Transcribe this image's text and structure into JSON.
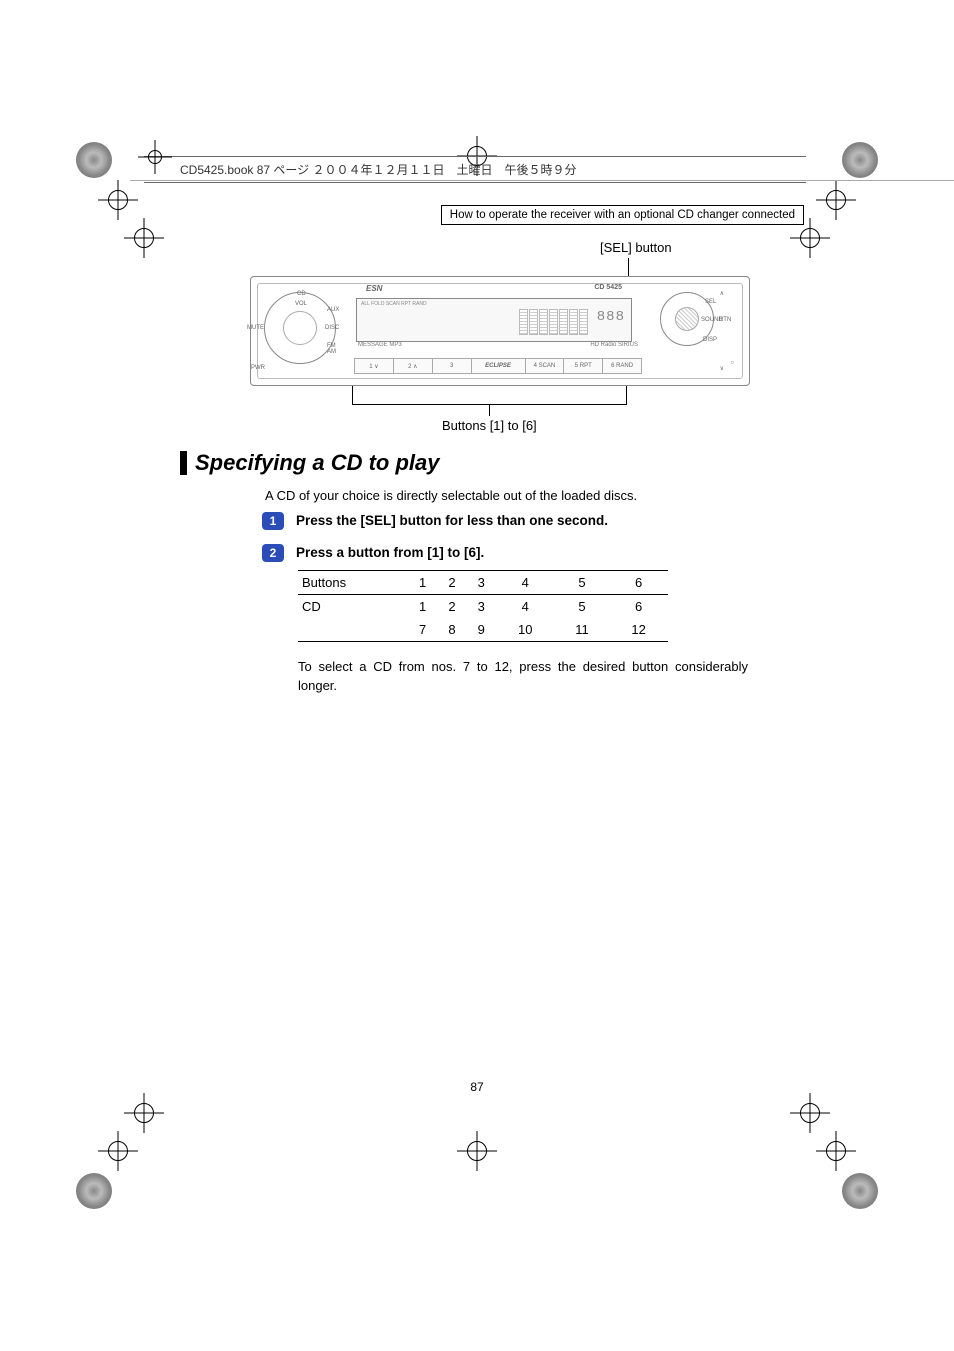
{
  "book_header": "CD5425.book  87 ページ  ２００４年１２月１１日　土曜日　午後５時９分",
  "section_box": "How to operate the receiver with an optional CD changer connected",
  "labels": {
    "sel": "[SEL] button",
    "buttons_caption": "Buttons [1] to [6]"
  },
  "device": {
    "brand_left": "ESN",
    "model": "CD 5425",
    "lcd_top_row": "ALL FOLD SCAN RPT RAND",
    "digits": "888",
    "left_knob": {
      "top": "CD",
      "vol": "VOL",
      "aux": "AUX",
      "disc": "DISC",
      "mute": "MUTE",
      "fm": "FM",
      "am": "AM",
      "pwr": "PWR"
    },
    "right_knob": {
      "sel": "SEL",
      "sound": "SOUND",
      "rtn": "RTN",
      "disp": "DISP"
    },
    "mid_left": "MESSAGE MP3",
    "mid_right": "HD Radio  SIRIUS",
    "logo": "ECLIPSE",
    "buttons": [
      "1  ∨",
      "2  ∧",
      "3",
      "4  SCAN",
      "5  RPT",
      "6  RAND"
    ]
  },
  "heading": "Specifying a CD to play",
  "intro": "A CD of your choice is directly selectable out of the loaded discs.",
  "steps": {
    "s1": {
      "num": "1",
      "text": "Press the [SEL] button for less than one second."
    },
    "s2": {
      "num": "2",
      "text": "Press a button from [1] to [6]."
    }
  },
  "table": {
    "header": [
      "Buttons",
      "1",
      "2",
      "3",
      "4",
      "5",
      "6"
    ],
    "row_cd": [
      "CD",
      "1",
      "2",
      "3",
      "4",
      "5",
      "6"
    ],
    "row_cd2": [
      "",
      "7",
      "8",
      "9",
      "10",
      "11",
      "12"
    ]
  },
  "note": "To select a CD from nos. 7 to 12, press the desired button considerably longer.",
  "page_number": "87"
}
